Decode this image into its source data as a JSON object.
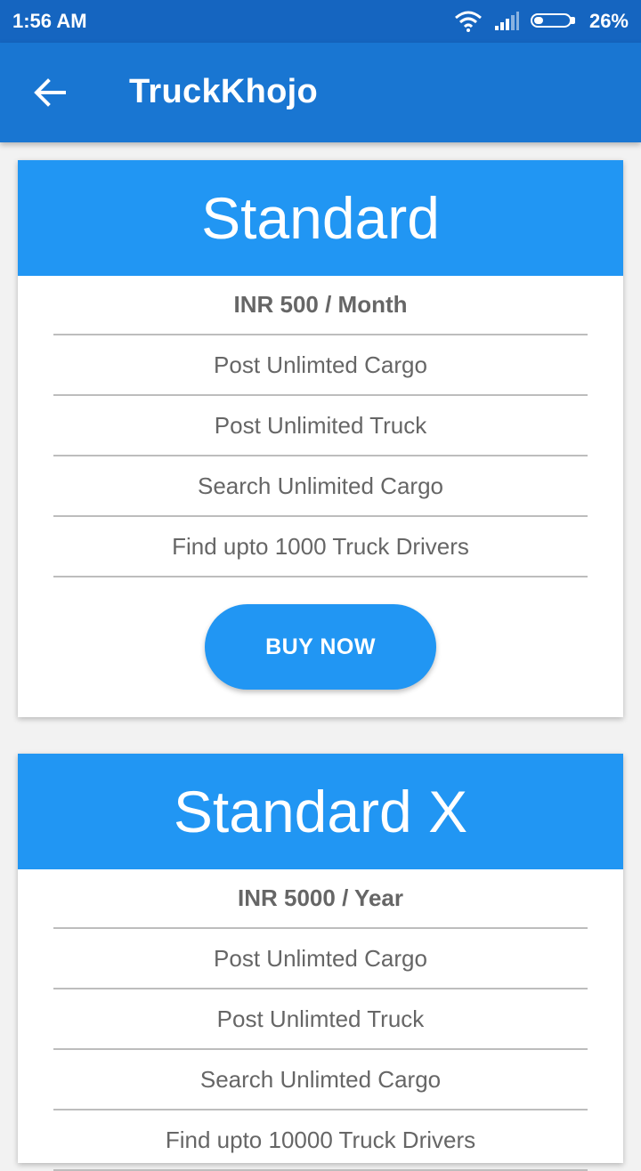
{
  "status_bar": {
    "time": "1:56 AM",
    "battery": "26%",
    "icons": [
      "wifi-icon",
      "signal-icon",
      "battery-icon"
    ]
  },
  "app_bar": {
    "title": "TruckKhojo",
    "back_icon": "arrow-left-icon"
  },
  "plans": [
    {
      "name": "Standard",
      "price": "INR 500 / Month",
      "features": [
        "Post Unlimted Cargo",
        "Post Unlimited Truck",
        "Search Unlimited Cargo",
        "Find upto 1000 Truck Drivers"
      ],
      "button": "BUY NOW"
    },
    {
      "name": "Standard X",
      "price": "INR 5000 / Year",
      "features": [
        "Post Unlimted Cargo",
        "Post Unlimted Truck",
        "Search Unlimted Cargo",
        "Find upto 10000 Truck Drivers"
      ]
    }
  ],
  "colors": {
    "status_bar": "#1565c0",
    "app_bar": "#1976d2",
    "accent": "#2196f3",
    "text_gray": "#666666"
  }
}
